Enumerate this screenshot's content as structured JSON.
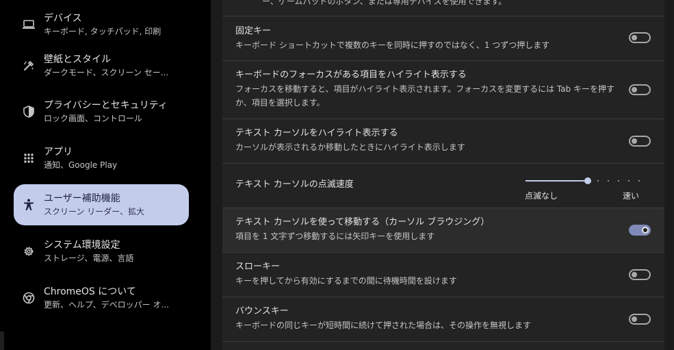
{
  "sidebar": {
    "items": [
      {
        "title": "デバイス",
        "sub": "キーボード, タッチパッド, 印刷",
        "icon": "laptop-icon"
      },
      {
        "title": "壁紙とスタイル",
        "sub": "ダークモード、スクリーン セー...",
        "icon": "paintbrush-icon"
      },
      {
        "title": "プライバシーとセキュリティ",
        "sub": "ロック画面、コントロール",
        "icon": "shield-icon"
      },
      {
        "title": "アプリ",
        "sub": "通知、Google Play",
        "icon": "apps-grid-icon"
      },
      {
        "title": "ユーザー補助機能",
        "sub": "スクリーン リーダー、拡大",
        "icon": "accessibility-icon",
        "active": true
      },
      {
        "title": "システム環境設定",
        "sub": "ストレージ、電源、言語",
        "icon": "gear-icon"
      },
      {
        "title": "ChromeOS について",
        "sub": "更新、ヘルプ、デベロッパー オ...",
        "icon": "chrome-icon"
      }
    ]
  },
  "main": {
    "top_cut_text": "ー、ゲームパッドのボタン、または専用デバイスを使用できます。",
    "rows": [
      {
        "title": "固定キー",
        "desc": "キーボード ショートカットで複数のキーを同時に押すのではなく、1 つずつ押します",
        "toggle": false
      },
      {
        "title": "キーボードのフォーカスがある項目をハイライト表示する",
        "desc": "フォーカスを移動すると、項目がハイライト表示されます。フォーカスを変更するには Tab キーを押すか、項目を選択します。",
        "toggle": false
      },
      {
        "title": "テキスト カーソルをハイライト表示する",
        "desc": "カーソルが表示されるか移動したときにハイライト表示します",
        "toggle": false
      },
      {
        "title": "テキスト カーソルの点滅速度",
        "slider_min_label": "点滅なし",
        "slider_max_label": "速い",
        "slider_value": 0.55
      },
      {
        "title": "テキスト カーソルを使って移動する（カーソル ブラウジング）",
        "desc": "項目を 1 文字ずつ移動するには矢印キーを使用します",
        "toggle": true
      },
      {
        "title": "スローキー",
        "desc": "キーを押してから有効にするまでの間に待機時間を設けます",
        "toggle": false
      },
      {
        "title": "バウンスキー",
        "desc": "キーボードの同じキーが短時間に続けて押された場合は、その操作を無視します",
        "toggle": false
      }
    ]
  },
  "colors": {
    "accent": "#c3cdeb",
    "toggle_on": "#7f8ab8",
    "background": "#232323"
  }
}
